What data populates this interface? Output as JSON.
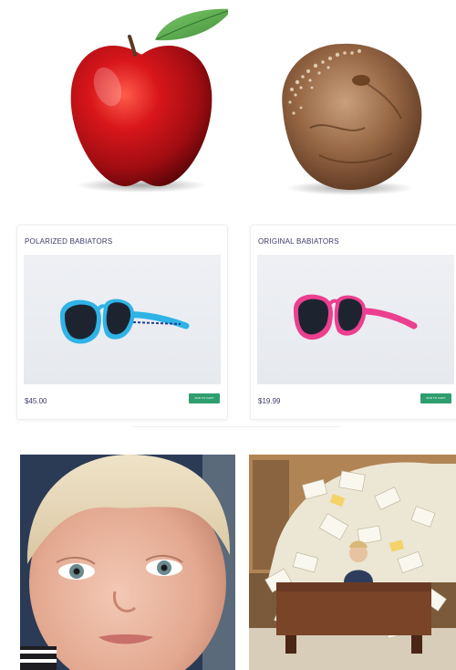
{
  "products": [
    {
      "title": "POLARIZED BABIATORS",
      "price": "$45.00",
      "cart_label": "ADD TO CART",
      "frame_color": "#2fb3e6"
    },
    {
      "title": "ORIGINAL BABIATORS",
      "price": "$19.99",
      "cart_label": "ADD TO CART",
      "frame_color": "#ec3f8f"
    }
  ],
  "colors": {
    "title_text": "#3b3a6b",
    "cart_button": "#2e9e6e",
    "fresh_apple": "#c0141a",
    "rotten_apple": "#9a6a47"
  }
}
